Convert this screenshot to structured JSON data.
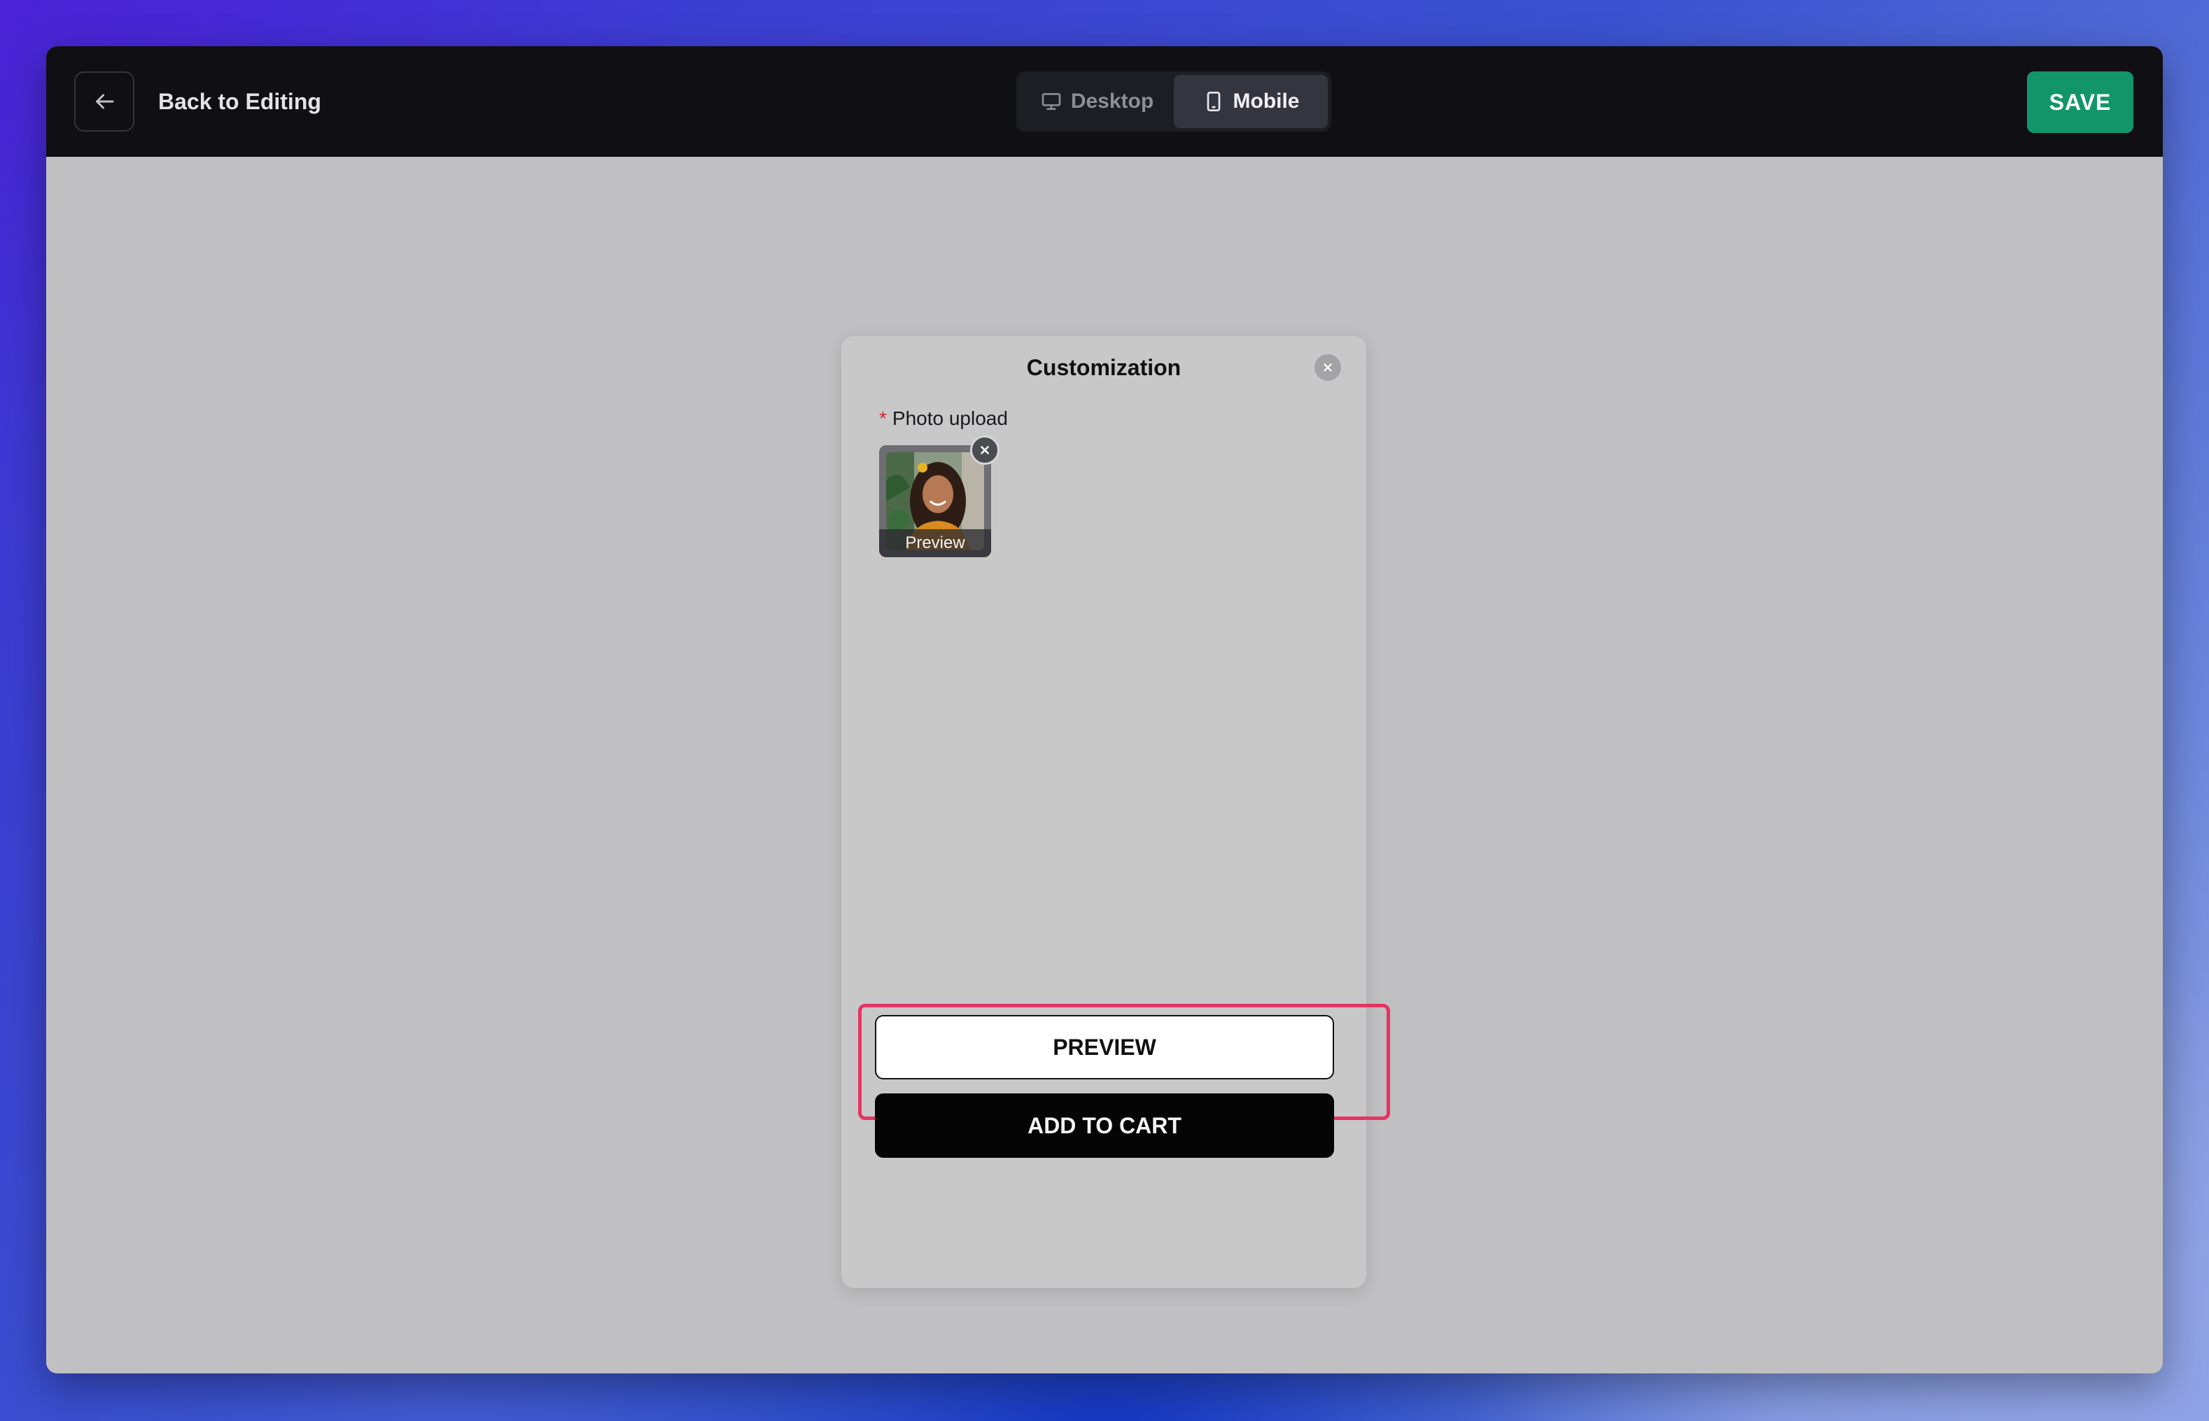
{
  "topbar": {
    "back_label": "Back to Editing",
    "view_options": [
      {
        "label": "Desktop",
        "icon": "monitor-icon",
        "active": false
      },
      {
        "label": "Mobile",
        "icon": "phone-icon",
        "active": true
      }
    ],
    "save_label": "SAVE"
  },
  "modal": {
    "title": "Customization",
    "field": {
      "required_mark": "*",
      "label": "Photo upload",
      "thumbnail_caption": "Preview"
    },
    "preview_button": "PREVIEW",
    "add_to_cart_button": "ADD TO CART"
  },
  "colors": {
    "save_green": "#13956a",
    "highlight_pink": "#e63462",
    "topbar_bg": "#0f0f14",
    "canvas_bg": "#c0c0c2"
  }
}
